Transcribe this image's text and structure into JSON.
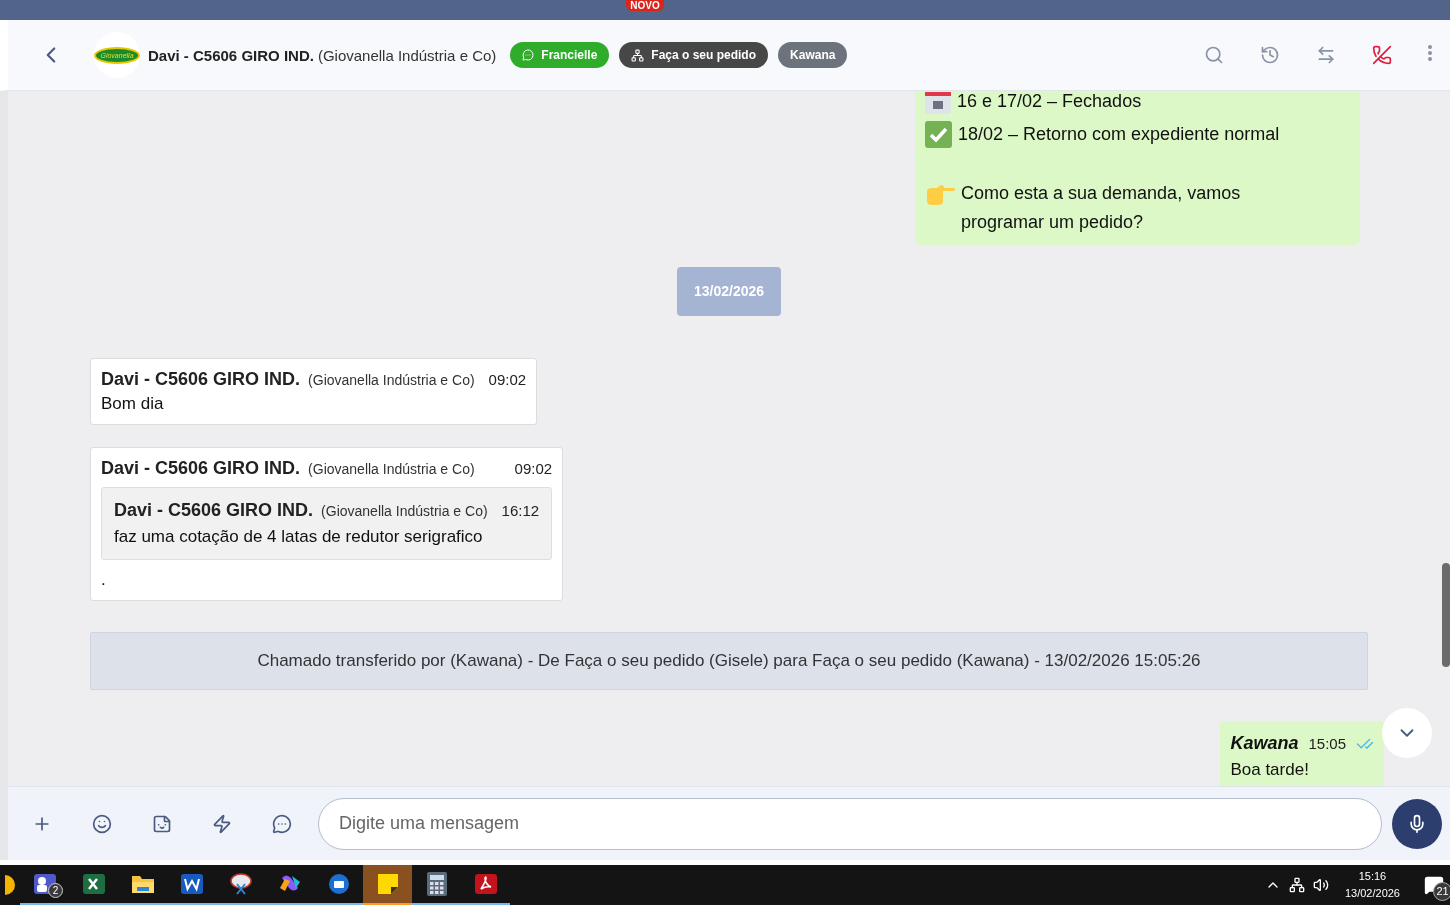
{
  "top_bar": {
    "badge": "NOVO"
  },
  "header": {
    "logo_text": "Giovanella",
    "contact": "Davi - C5606 GIRO IND.",
    "company": "(Giovanella Indústria e Co)",
    "tags": [
      {
        "label": "Francielle",
        "kind": "whatsapp",
        "color": "#2fac2a"
      },
      {
        "label": "Faça o seu pedido",
        "kind": "queue",
        "color": "#474747"
      },
      {
        "label": "Kawana",
        "kind": "user",
        "color": "#6d737c"
      }
    ],
    "actions": [
      {
        "kind": "search"
      },
      {
        "kind": "history"
      },
      {
        "kind": "transfer"
      },
      {
        "kind": "hangup"
      },
      {
        "kind": "more"
      }
    ]
  },
  "messages": [
    {
      "kind": "outgoing_list",
      "lines": [
        {
          "kind": "calendar",
          "text": "16 e 17/02 – Fechados"
        },
        {
          "kind": "check",
          "text": "18/02 – Retorno com expediente normal"
        },
        {
          "kind": "pointing",
          "text": "Como esta a sua demanda, vamos programar um pedido?"
        }
      ]
    },
    {
      "kind": "date",
      "text": "13/02/2026"
    },
    {
      "kind": "incoming",
      "sender": "Davi - C5606 GIRO IND.",
      "company": "(Giovanella Indústria e Co)",
      "time": "09:02",
      "text": "Bom dia"
    },
    {
      "kind": "incoming",
      "sender": "Davi - C5606 GIRO IND.",
      "company": "(Giovanella Indústria e Co)",
      "time": "09:02",
      "text": ".",
      "quote": {
        "sender": "Davi - C5606 GIRO IND.",
        "company": "(Giovanella Indústria e Co)",
        "time": "16:12",
        "text": "faz uma cotação de 4 latas de redutor serigrafico"
      }
    },
    {
      "kind": "system",
      "text": "Chamado transferido por (Kawana) - De Faça o seu pedido (Gisele) para Faça o seu pedido (Kawana) - 13/02/2026 15:05:26"
    },
    {
      "kind": "outgoing",
      "sender": "Kawana",
      "time": "15:05",
      "read": true,
      "text": "Boa tarde!"
    }
  ],
  "composer": {
    "placeholder": "Digite uma mensagem",
    "tools": [
      {
        "kind": "plus"
      },
      {
        "kind": "emoji"
      },
      {
        "kind": "sticker"
      },
      {
        "kind": "quick"
      },
      {
        "kind": "chat"
      }
    ]
  },
  "taskbar": {
    "apps": [
      {
        "kind": "chrome",
        "selected": false
      },
      {
        "kind": "teams",
        "badge": "2",
        "selected": false
      },
      {
        "kind": "excel",
        "selected": false
      },
      {
        "kind": "folder",
        "selected": false
      },
      {
        "kind": "word",
        "selected": false
      },
      {
        "kind": "snip",
        "selected": false
      },
      {
        "kind": "copilot",
        "selected": false
      },
      {
        "kind": "thunderbird",
        "selected": false
      },
      {
        "kind": "notes",
        "selected": true
      },
      {
        "kind": "calculator",
        "selected": false
      },
      {
        "kind": "pdf",
        "selected": false
      }
    ],
    "time": "15:16",
    "date": "13/02/2026",
    "notifications": "21"
  }
}
